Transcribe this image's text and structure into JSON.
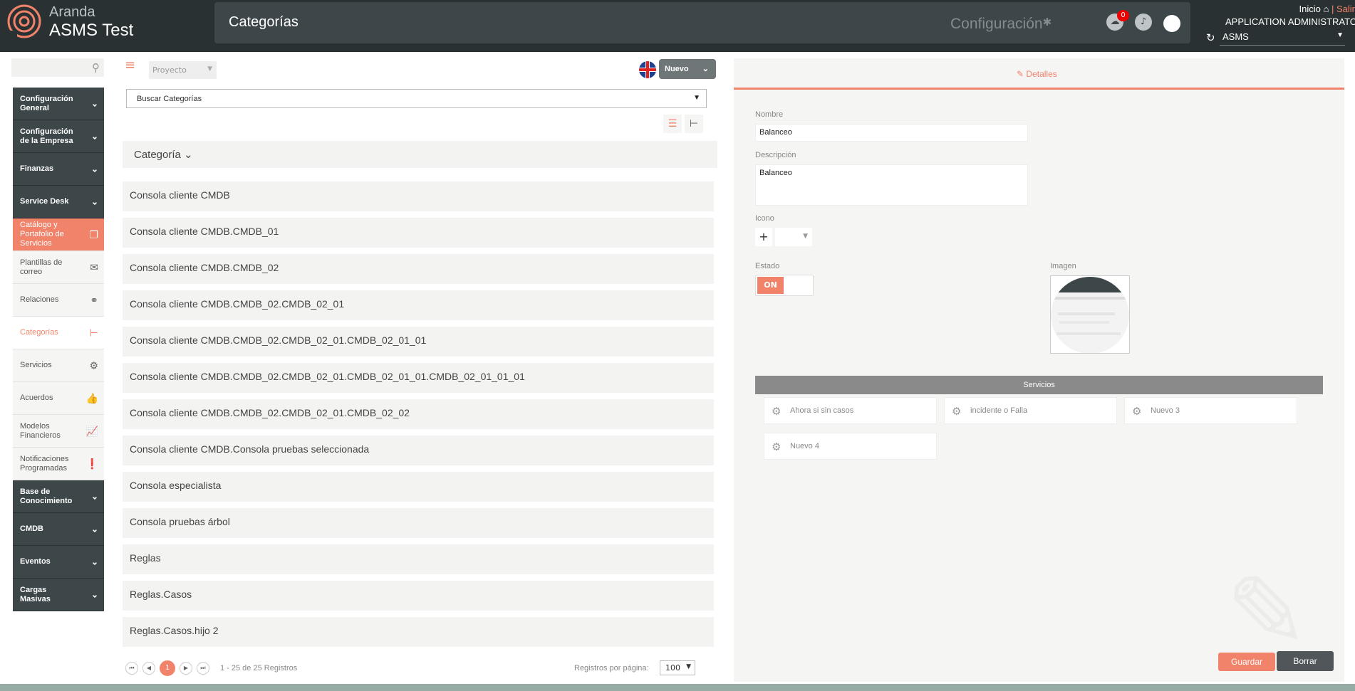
{
  "brand": {
    "line1": "Aranda",
    "line2": "ASMS Test"
  },
  "header": {
    "title": "Categorías",
    "config_label": "Configuración",
    "notification_count": "0",
    "inicio": "Inicio",
    "separator": "|",
    "salir": "Salir",
    "user": "APPLICATION ADMINISTRATOR",
    "system": "ASMS"
  },
  "sidebar": {
    "items": [
      {
        "label": "Configuración General",
        "style": "dark",
        "icon": "chevron-down-icon"
      },
      {
        "label": "Configuración de la Empresa",
        "style": "dark",
        "icon": "chevron-down-icon"
      },
      {
        "label": "Finanzas",
        "style": "dark",
        "icon": "chevron-down-icon"
      },
      {
        "label": "Service Desk",
        "style": "dark",
        "icon": "chevron-down-icon"
      },
      {
        "label": "Catálogo y Portafolio de Servicios",
        "style": "active",
        "icon": "catalog-icon"
      },
      {
        "label": "Plantillas de correo",
        "style": "light",
        "icon": "envelope-icon"
      },
      {
        "label": "Relaciones",
        "style": "light",
        "icon": "relations-icon"
      },
      {
        "label": "Categorías",
        "style": "current",
        "icon": "category-tree-icon"
      },
      {
        "label": "Servicios",
        "style": "light",
        "icon": "services-icon"
      },
      {
        "label": "Acuerdos",
        "style": "light",
        "icon": "thumbs-up-icon"
      },
      {
        "label": "Modelos Financieros",
        "style": "light",
        "icon": "chart-icon"
      },
      {
        "label": "Notificaciones Programadas",
        "style": "light",
        "icon": "notification-icon"
      },
      {
        "label": "Base de Conocimiento",
        "style": "dark",
        "icon": "chevron-down-icon"
      },
      {
        "label": "CMDB",
        "style": "dark",
        "icon": "chevron-down-icon"
      },
      {
        "label": "Eventos",
        "style": "dark",
        "icon": "chevron-down-icon"
      },
      {
        "label": "Cargas Masivas",
        "style": "dark",
        "icon": "chevron-down-icon"
      }
    ]
  },
  "toolbar": {
    "project": "Proyecto",
    "new_label": "Nuevo"
  },
  "search": {
    "value": "Buscar Categorías"
  },
  "list": {
    "header": "Categoría",
    "rows": [
      "Consola cliente CMDB",
      "Consola cliente CMDB.CMDB_01",
      "Consola cliente CMDB.CMDB_02",
      "Consola cliente CMDB.CMDB_02.CMDB_02_01",
      "Consola cliente CMDB.CMDB_02.CMDB_02_01.CMDB_02_01_01",
      "Consola cliente CMDB.CMDB_02.CMDB_02_01.CMDB_02_01_01.CMDB_02_01_01_01",
      "Consola cliente CMDB.CMDB_02.CMDB_02_01.CMDB_02_02",
      "Consola cliente CMDB.Consola pruebas seleccionada",
      "Consola especialista",
      "Consola pruebas árbol",
      "Reglas",
      "Reglas.Casos",
      "Reglas.Casos.hijo 2"
    ]
  },
  "pager": {
    "current": "1",
    "info": "1 - 25 de 25 Registros",
    "per_page_label": "Registros por página:",
    "per_page": "100"
  },
  "details": {
    "tab": "Detalles",
    "name_label": "Nombre",
    "name_value": "Balanceo",
    "desc_label": "Descripción",
    "desc_value": "Balanceo",
    "icon_label": "Icono",
    "icon_add": "+",
    "state_label": "Estado",
    "state_value": "ON",
    "image_label": "Imagen",
    "services_header": "Servicios",
    "services": [
      "Ahora si sin casos",
      "incidente o Falla",
      "Nuevo 3",
      "Nuevo 4"
    ],
    "save": "Guardar",
    "delete": "Borrar"
  },
  "colors": {
    "accent": "#f2836b",
    "dark": "#293133",
    "sidebar_dark": "#3d474a"
  }
}
